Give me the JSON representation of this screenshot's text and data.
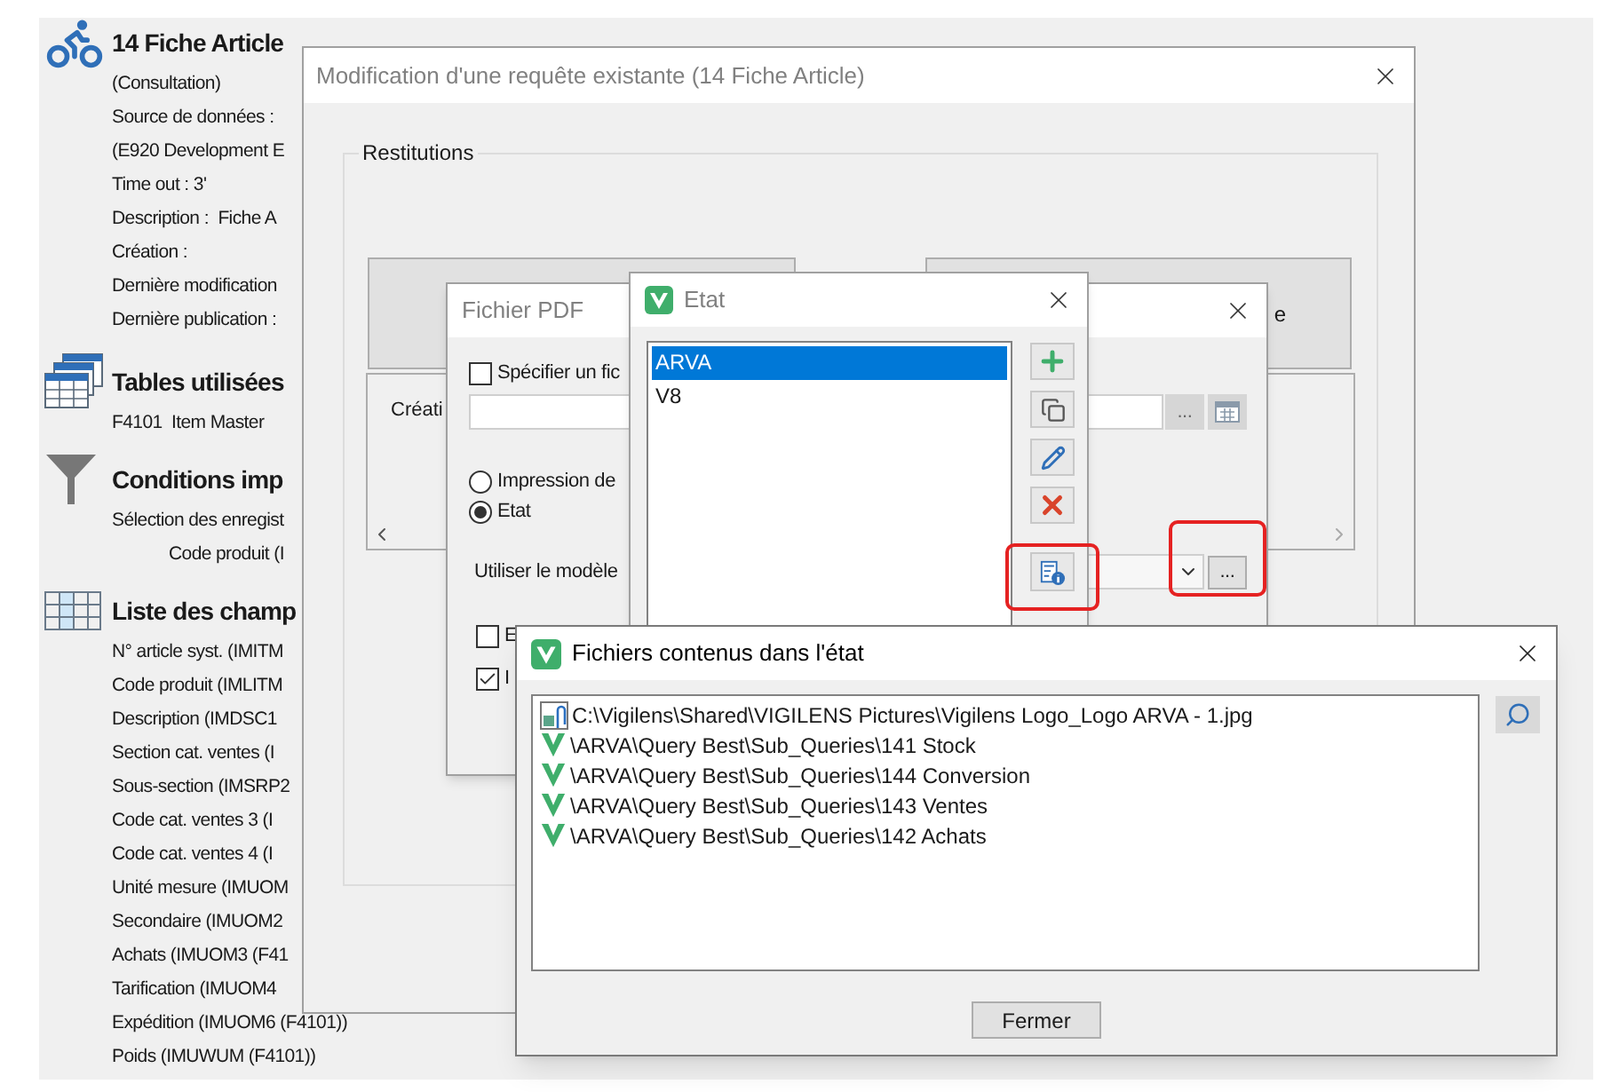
{
  "sidebar": {
    "title": "14 Fiche Article",
    "details": [
      "(Consultation)",
      "Source de données :",
      "(E920 Development E",
      "Time out : 3'",
      "Description :  Fiche A",
      "Création :",
      "Dernière modification",
      "Dernière publication :"
    ],
    "sections": [
      {
        "kind": "tables",
        "title": "Tables utilisées",
        "items": [
          {
            "text": "F4101  Item Master"
          }
        ]
      },
      {
        "kind": "conditions",
        "title": "Conditions imp",
        "items": [
          {
            "text": "Sélection des enregist",
            "children": [
              {
                "text": "Code produit (I"
              }
            ]
          }
        ]
      },
      {
        "kind": "fields",
        "title": "Liste des champ",
        "items": [
          {
            "text": "N° article syst. (IMITM"
          },
          {
            "text": "Code produit (IMLITM"
          },
          {
            "text": "Description (IMDSC1"
          },
          {
            "text": "Section cat. ventes (I"
          },
          {
            "text": "Sous-section (IMSRP2"
          },
          {
            "text": "Code cat. ventes 3 (I"
          },
          {
            "text": "Code cat. ventes 4 (I"
          },
          {
            "text": "Unité mesure (IMUOM"
          },
          {
            "text": "Secondaire (IMUOM2"
          },
          {
            "text": "Achats (IMUOM3 (F41"
          },
          {
            "text": "Tarification (IMUOM4"
          },
          {
            "text": "Expédition (IMUOM6 (F4101))"
          },
          {
            "text": "Poids (IMUWUM (F4101))"
          }
        ]
      }
    ]
  },
  "main_dialog": {
    "title": "Modification d'une requête existante (14 Fiche Article)",
    "group_label": "Restitutions",
    "right_tile_text": "e",
    "panel_label": "Créati"
  },
  "pdf_dialog": {
    "title": "Fichier PDF",
    "specify": {
      "label": "Spécifier un fic",
      "checked": false
    },
    "browse_buttons": [
      "...",
      "..."
    ],
    "options": [
      {
        "label": "Impression de",
        "selected": false
      },
      {
        "label": "Etat",
        "selected": true
      }
    ],
    "template_label": "Utiliser le modèle",
    "checks": [
      {
        "label": "E",
        "checked": false
      },
      {
        "label": "I",
        "checked": true
      }
    ]
  },
  "etat_dialog": {
    "title": "Etat",
    "items": [
      {
        "label": "ARVA",
        "selected": true
      },
      {
        "label": "V8",
        "selected": false
      }
    ]
  },
  "files_dialog": {
    "title": "Fichiers contenus dans l'état",
    "files": [
      {
        "kind": "image",
        "path": "C:\\Vigilens\\Shared\\VIGILENS Pictures\\Vigilens Logo_Logo ARVA - 1.jpg"
      },
      {
        "kind": "query",
        "path": "\\ARVA\\Query Best\\Sub_Queries\\141 Stock"
      },
      {
        "kind": "query",
        "path": "\\ARVA\\Query Best\\Sub_Queries\\144 Conversion"
      },
      {
        "kind": "query",
        "path": "\\ARVA\\Query Best\\Sub_Queries\\143 Ventes"
      },
      {
        "kind": "query",
        "path": "\\ARVA\\Query Best\\Sub_Queries\\142 Achats"
      }
    ],
    "close_button": "Fermer"
  }
}
